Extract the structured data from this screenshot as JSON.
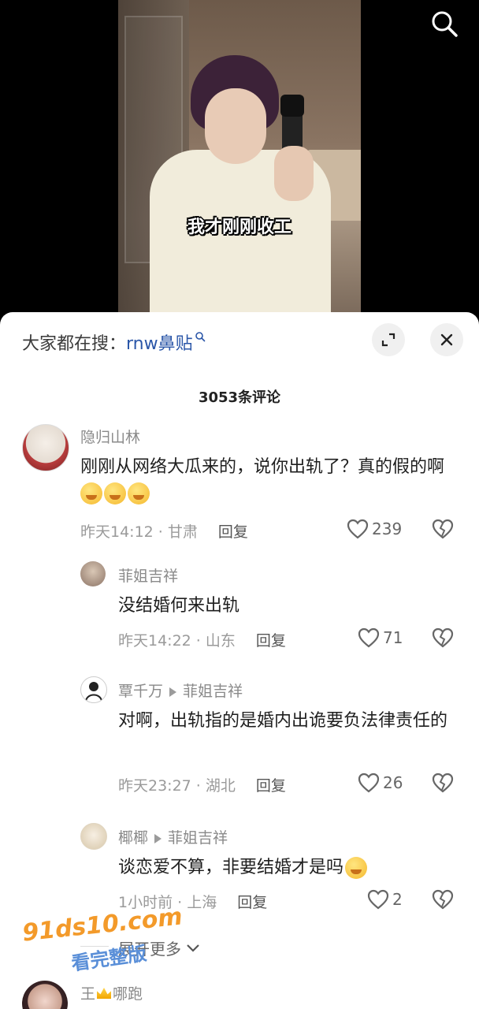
{
  "video": {
    "subtitle": "我才刚刚收工"
  },
  "icons": {
    "search": "search-icon",
    "expand": "expand-icon",
    "close": "close-icon",
    "heart": "heart-icon",
    "broken_heart": "broken-heart-icon",
    "chevron_down": "chevron-down-icon"
  },
  "search_bar": {
    "prefix": "大家都在搜：",
    "term": "rnw鼻贴"
  },
  "comments_header": {
    "count_label": "3053条评论"
  },
  "comments": [
    {
      "author": "隐归山林",
      "text": "刚刚从网络大瓜来的，说你出轨了？真的假的啊",
      "emoji_count": 3,
      "time_location": "昨天14:12 · 甘肃",
      "reply_label": "回复",
      "likes": "239"
    },
    {
      "author": "菲姐吉祥",
      "text": "没结婚何来出轨",
      "time_location": "昨天14:22 · 山东",
      "reply_label": "回复",
      "likes": "71"
    },
    {
      "author": "覃千万",
      "reply_to": "菲姐吉祥",
      "text": "对啊，出轨指的是婚内出诡要负法律责任的",
      "time_location": "昨天23:27 · 湖北",
      "reply_label": "回复",
      "likes": "26"
    },
    {
      "author": "椰椰",
      "reply_to": "菲姐吉祥",
      "text": "谈恋爱不算，非要结婚才是吗",
      "time_location": "1小时前 · 上海",
      "reply_label": "回复",
      "likes": "2"
    },
    {
      "author_prefix": "王",
      "author_suffix": "哪跑"
    }
  ],
  "expand_more_label": "展开更多",
  "watermark": {
    "site": "91ds10.com",
    "slogan": "看完整版"
  },
  "colors": {
    "accent_link": "#2a56a8",
    "meta_gray": "#9a9a9a",
    "watermark_orange": "#f39a2a",
    "watermark_blue": "#5a8fd8"
  }
}
